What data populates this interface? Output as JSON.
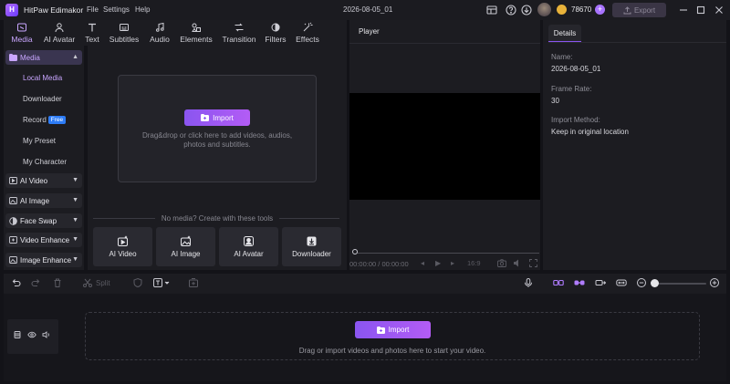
{
  "app": {
    "title": "HitPaw Edimakor",
    "logo_text": "H"
  },
  "menu": [
    "File",
    "Settings",
    "Help"
  ],
  "document_title": "2026-08-05_01",
  "header": {
    "credits": "78670",
    "plus": "+",
    "export_label": "Export"
  },
  "tabs": [
    {
      "label": "Media",
      "icon": "media-icon"
    },
    {
      "label": "AI Avatar",
      "icon": "avatar-icon"
    },
    {
      "label": "Text",
      "icon": "text-icon"
    },
    {
      "label": "Subtitles",
      "icon": "subtitles-icon"
    },
    {
      "label": "Audio",
      "icon": "audio-icon"
    },
    {
      "label": "Elements",
      "icon": "elements-icon"
    },
    {
      "label": "Transition",
      "icon": "transition-icon"
    },
    {
      "label": "Filters",
      "icon": "filters-icon"
    },
    {
      "label": "Effects",
      "icon": "effects-icon"
    }
  ],
  "sidebar": {
    "media_header": "Media",
    "media_items": [
      "Local Media",
      "Downloader",
      "Record",
      "My Preset",
      "My Character"
    ],
    "free_badge": "Free",
    "groups": [
      "AI Video",
      "AI Image",
      "Face Swap",
      "Video Enhance",
      "Image Enhance"
    ]
  },
  "media_panel": {
    "import_label": "Import",
    "drop_hint_1": "Drag&drop or click here to add videos, audios,",
    "drop_hint_2": "photos and subtitles.",
    "tools_caption": "No media? Create with these tools",
    "tools": [
      "AI Video",
      "AI Image",
      "AI Avatar",
      "Downloader"
    ]
  },
  "player": {
    "title": "Player",
    "time": "00:00:00 / 00:00:00",
    "aspect": "16:9"
  },
  "details": {
    "tab": "Details",
    "fields": [
      {
        "label": "Name:",
        "value": "2026-08-05_01"
      },
      {
        "label": "Frame Rate:",
        "value": "30"
      },
      {
        "label": "Import Method:",
        "value": "Keep in original location"
      }
    ]
  },
  "timeline_toolbar": {
    "split_label": "Split"
  },
  "timeline": {
    "import_label": "Import",
    "hint": "Drag or import videos and photos here to start your video."
  },
  "colors": {
    "accent": "#9b5cf6",
    "background": "#131318",
    "panel": "#1c1c21",
    "free_badge": "#2d7cf6"
  }
}
